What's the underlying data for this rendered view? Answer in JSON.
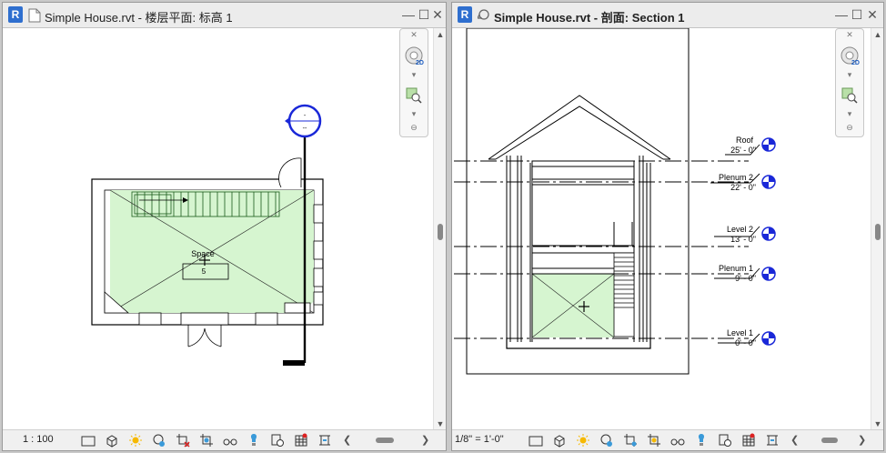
{
  "left_window": {
    "title": "Simple House.rvt - 楼层平面: 标高 1",
    "scale": "1 : 100",
    "space_label": "Space",
    "space_number": "5",
    "section_head_top": "-",
    "section_head_bottom": "--",
    "icons": [
      "app-icon",
      "document-icon",
      "minimize-icon",
      "maximize-icon",
      "close-icon",
      "steering-wheel-icon",
      "zoom-region-icon",
      "detail-level-icon",
      "visual-style-icon",
      "sun-path-icon",
      "shadows-icon",
      "crop-view-icon",
      "hide-crop-icon",
      "temporary-hide-icon",
      "reveal-hidden-icon",
      "lock-view-icon",
      "highlight-displacement-icon",
      "reveal-constraints-icon",
      "analytical-model-icon"
    ]
  },
  "right_window": {
    "title": "Simple House.rvt - 剖面: Section 1",
    "scale": "1/8\" = 1'-0\"",
    "levels": [
      {
        "name": "Roof",
        "elevation": "25' - 0\""
      },
      {
        "name": "Plenum 2",
        "elevation": "22' - 0\""
      },
      {
        "name": "Level 2",
        "elevation": "13' - 0\""
      },
      {
        "name": "Plenum 1",
        "elevation": "9' - 0\""
      },
      {
        "name": "Level 1",
        "elevation": "0' - 0\""
      }
    ]
  },
  "colors": {
    "space_fill": "#d6f5d0",
    "level_head": "#1a28d8",
    "app_icon": "#2f6fcf"
  }
}
